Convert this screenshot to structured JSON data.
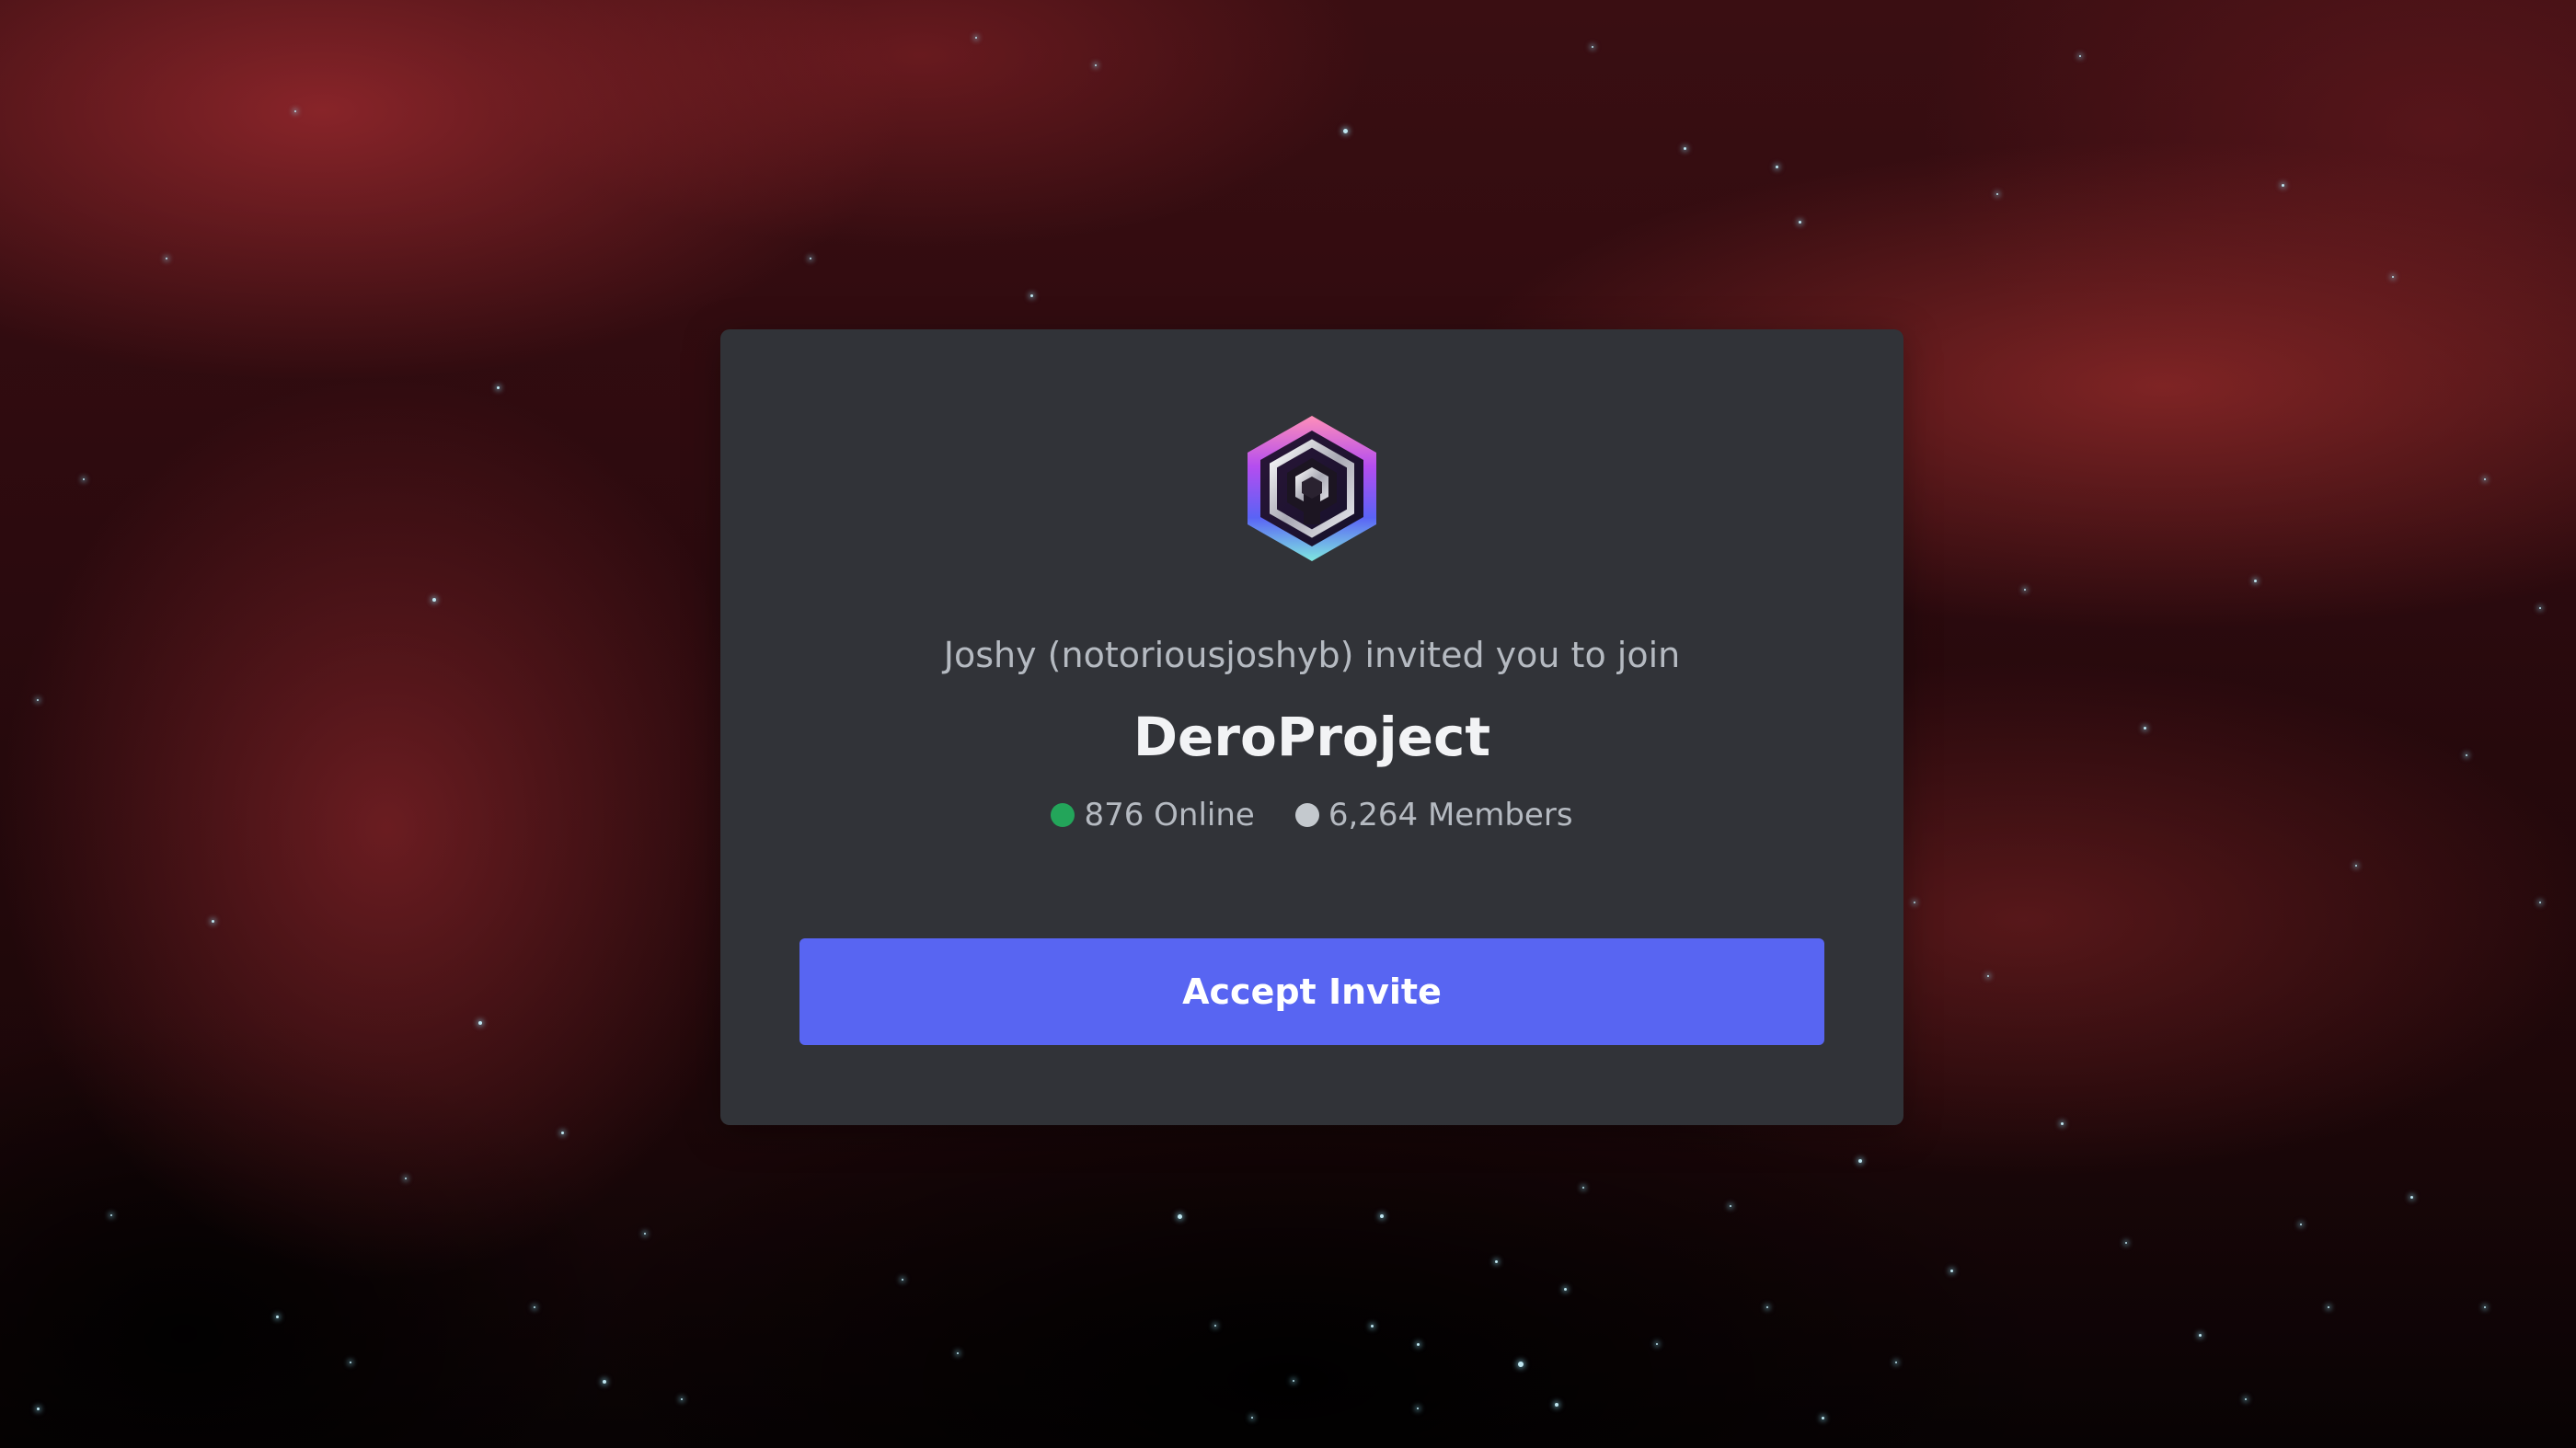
{
  "invite": {
    "inviter_text": "Joshy (notoriousjoshyb) invited you to join",
    "server_name": "DeroProject",
    "online_text": "876 Online",
    "members_text": "6,264 Members",
    "accept_label": "Accept Invite"
  },
  "icons": {
    "server_icon": "server-logo-hexagon-icon",
    "online_dot": "online-status-dot",
    "members_dot": "members-status-dot"
  },
  "colors": {
    "card_background": "#313338",
    "accent": "#5865f2",
    "online": "#23a55a",
    "members": "#c4c9ce",
    "secondary_text": "#b5bac1",
    "primary_text": "#f2f3f5"
  }
}
